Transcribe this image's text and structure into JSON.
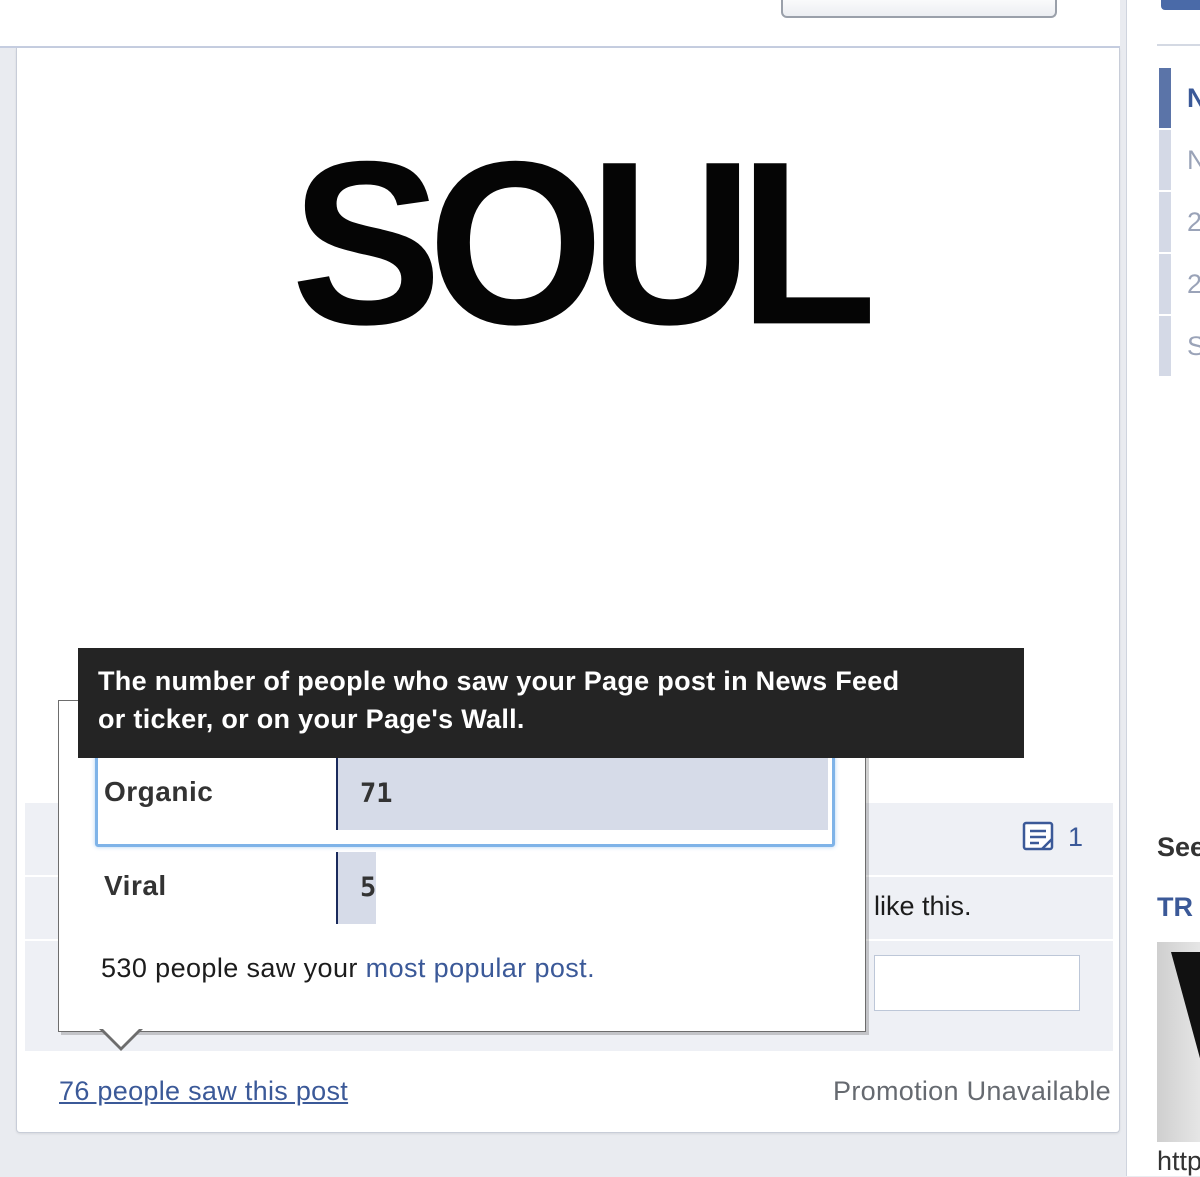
{
  "post": {
    "image_text": "SOUL",
    "comment_count": "1",
    "likes_suffix": "like this.",
    "reach_link": "76 people saw this post",
    "promotion_status": "Promotion Unavailable"
  },
  "tooltip": {
    "line1": "The number of people who saw your Page post in News Feed",
    "line2": "or ticker, or on your Page's Wall."
  },
  "reach_breakdown": {
    "rows": [
      {
        "label": "Organic",
        "value": 71
      },
      {
        "label": "Viral",
        "value": 5
      }
    ],
    "footer_prefix": "530 people saw your ",
    "footer_link": "most popular post."
  },
  "sidebar": {
    "items": [
      "N",
      "N",
      "2",
      "2",
      "S"
    ],
    "see_label": "See",
    "tr_label": "TR",
    "url_fragment": "http"
  }
}
